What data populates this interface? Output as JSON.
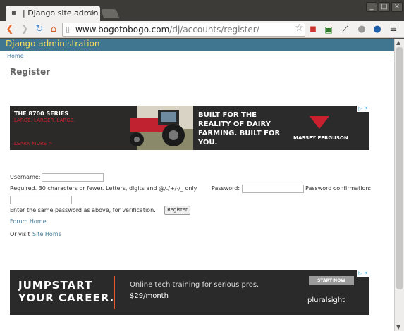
{
  "browser": {
    "tab_title": "| Django site admin",
    "tab_close": "×",
    "address_host": "www.bogotobogo.com",
    "address_path": "/dj/accounts/register/",
    "win_min": "_",
    "win_max": "□",
    "win_close": "×"
  },
  "django": {
    "brand": "Django administration",
    "breadcrumb_home": "Home",
    "page_title": "Register"
  },
  "ad_top": {
    "series": "THE 8700 SERIES",
    "tagline": "LARGE. LARGER. LARGE.",
    "cta": "LEARN MORE >",
    "headline": "BUILT FOR THE REALITY OF DAIRY FARMING. BUILT FOR YOU.",
    "brand": "MASSEY FERGUSON",
    "adchoices": "▷ ✕"
  },
  "form": {
    "username_label": "Username:",
    "help_prefix": "Required. 30 characters or fewer. Letters, digits and @/./+/-/_ only.",
    "password_label": "Password:",
    "password_confirm_label": "Password confirmation:",
    "password_help": "Enter the same password as above, for verification.",
    "submit_label": "Register",
    "forum_link": "Forum Home",
    "or_visit": "Or visit",
    "site_link": "Site Home"
  },
  "ad_bottom": {
    "line1": "JUMPSTART",
    "line2": "YOUR CAREER.",
    "copy": "Online tech training for serious pros.",
    "price": "$29/month",
    "button": "START NOW",
    "brand": "pluralsight",
    "adchoices": "▷ ✕"
  },
  "colors": {
    "django_header": "#417690",
    "django_brand": "#f5dd5d",
    "link": "#447e9b",
    "massey_red": "#c8202e",
    "pluralsight_orange": "#e5582d"
  }
}
